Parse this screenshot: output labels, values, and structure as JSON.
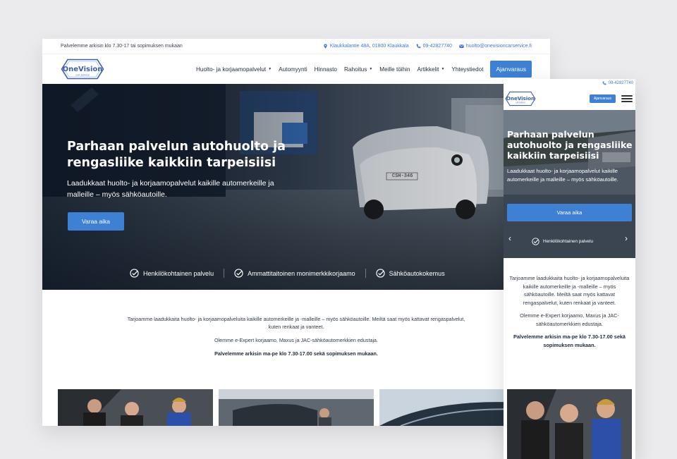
{
  "topbar": {
    "hours_text": "Palvelemme arkisin klo 7.30-17 tai sopimuksen mukaan",
    "address": "Klaukkalantie 48A, 01800 Klaukkala",
    "phone": "09-42827740",
    "email": "huolto@onevisioncarservice.fi"
  },
  "brand": {
    "name": "OneVision",
    "tagline": "CAR SERVICE",
    "accent": "#3e80d4"
  },
  "nav": {
    "items": [
      {
        "label": "Huolto- ja korjaamopalvelut",
        "dropdown": true
      },
      {
        "label": "Automyynti",
        "dropdown": false
      },
      {
        "label": "Hinnasto",
        "dropdown": false
      },
      {
        "label": "Rahoitus",
        "dropdown": true
      },
      {
        "label": "Meille töihin",
        "dropdown": false
      },
      {
        "label": "Artikkelit",
        "dropdown": true
      },
      {
        "label": "Yhteystiedot",
        "dropdown": false
      }
    ],
    "cta": "Ajanvaraus"
  },
  "hero": {
    "title": "Parhaan palvelun autohuolto ja rengasliike kaikkiin tarpeisiisi",
    "subtitle": "Laadukkaat huolto- ja korjaamopalvelut kaikille automerkeille ja malleille – myös sähköautoille.",
    "cta": "Varaa aika",
    "plate": "CSH-346",
    "features": [
      "Henkilökohtainen palvelu",
      "Ammattitaitoinen monimerkkikorjaamo",
      "Sähköautokokemus"
    ]
  },
  "intro": {
    "p1": "Tarjoamme laadukkaita huolto- ja korjaamopalveluita kaikille automerkeille ja -malleille – myös sähköautoille. Meiltä saat myös kattavat rengaspalvelut, kuten renkaat ja vanteet.",
    "p2": "Olemme e-Expert korjaamo, Maxus ja JAC-sähköautomerkkien edustaja.",
    "p3": "Palvelemme arkisin ma-pe klo 7.30-17.00 sekä sopimuksen mukaan."
  },
  "mobile": {
    "phone": "09-42827740",
    "cta": "Ajanvaraus",
    "hero_title": "Parhaan palvelun autohuolto ja rengasliike kaikkiin tarpeisiisi",
    "hero_subtitle": "Laadukkaat huolto- ja korjaamopalvelut kaikille automerkeille ja malleille – myös sähköautoille.",
    "hero_cta": "Varaa aika",
    "feature": "Henkilökohtainen palvelu",
    "intro_p1": "Tarjoamme laadukkaita huolto- ja korjaamopalveluita kaikille automerkeille ja -malleille – myös sähköautoille. Meiltä saat myös kattavat rengaspalvelut, kuten renkaat ja vanteet.",
    "intro_p2": "Olemme e-Expert korjaamo, Maxus ja JAC-sähköautomerkkien edustaja.",
    "intro_p3": "Palvelemme arkisin ma-pe klo 7.30-17.00 sekä sopimuksen mukaan."
  }
}
